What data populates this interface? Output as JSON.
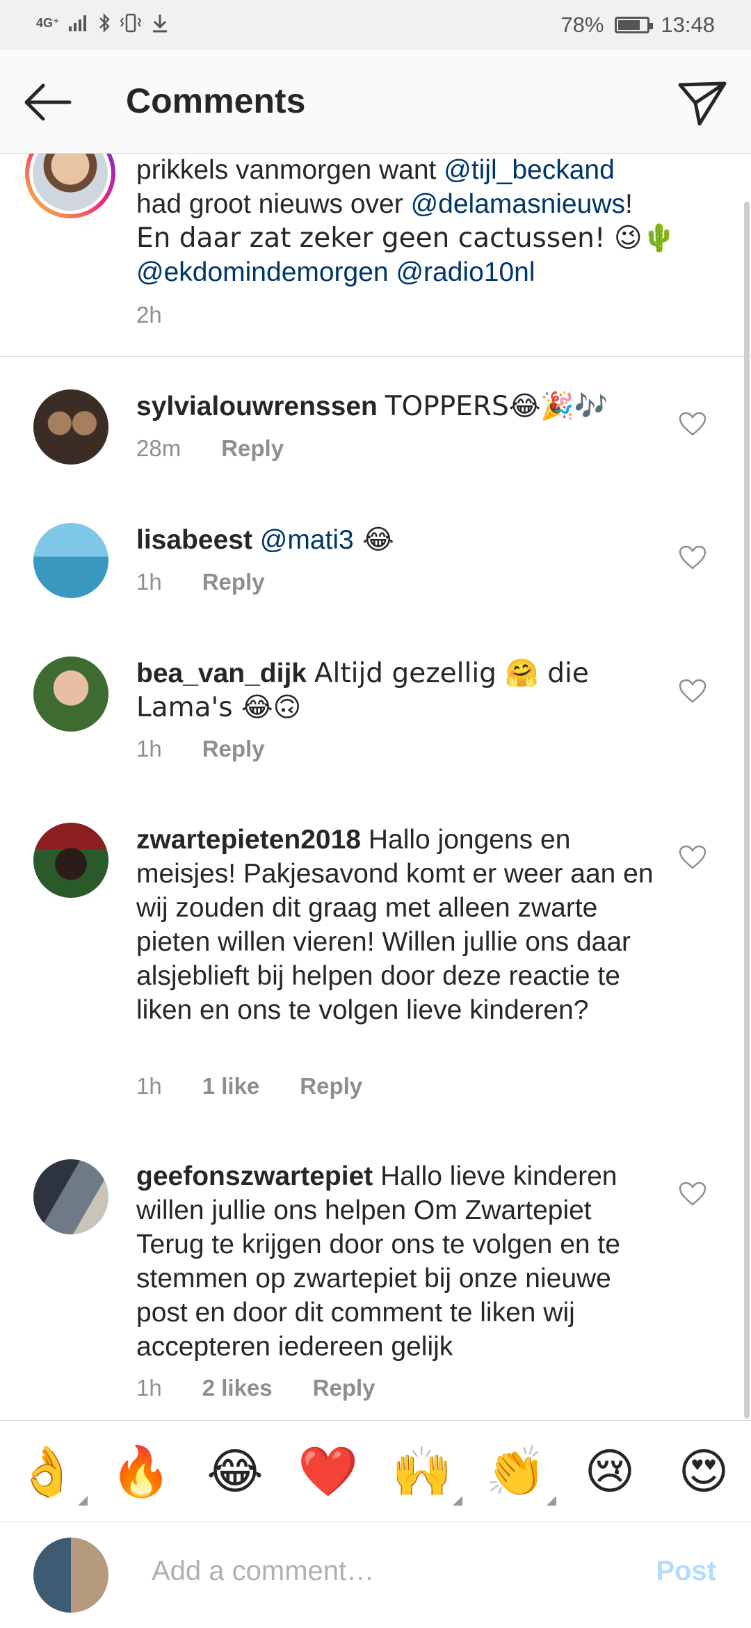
{
  "status_bar": {
    "network": "4G⁺",
    "battery_percent": "78%",
    "battery_level": 0.78,
    "time": "13:48"
  },
  "header": {
    "title": "Comments"
  },
  "caption": {
    "line1_text": "prikkels vanmorgen want ",
    "line1_mention": "@tijl_beckand",
    "line2_text": "had groot nieuws over ",
    "line2_mention": "@delamasnieuws",
    "line2_end": "!",
    "line3_text": "En daar zat zeker geen cactussen! 😉🌵",
    "line4_mention1": "@ekdomindemorgen",
    "line4_mention2": "@radio10nl",
    "time": "2h"
  },
  "comments": [
    {
      "username": "sylvialouwrenssen",
      "text": "TOPPERS😂🎉🎶",
      "time": "28m",
      "likes": "",
      "reply": "Reply",
      "avatar_color": "#4a3a30"
    },
    {
      "username": "lisabeest",
      "mention": "@mati3",
      "text": " 😂",
      "time": "1h",
      "likes": "",
      "reply": "Reply",
      "avatar_color": "#5fb0d4"
    },
    {
      "username": "bea_van_dijk",
      "text": "Altijd gezellig 🤗 die Lama's 😂🙃",
      "time": "1h",
      "likes": "",
      "reply": "Reply",
      "avatar_color": "#5a7a3a"
    },
    {
      "username": "zwartepieten2018",
      "text": "Hallo jongens en meisjes! Pakjesavond komt er weer aan en wij zouden dit graag met alleen zwarte pieten willen vieren! Willen jullie ons daar alsjeblieft bij helpen door deze reactie te liken en ons te volgen lieve kinderen?",
      "time": "1h",
      "likes": "1 like",
      "reply": "Reply",
      "avatar_color": "#2b4a2a"
    },
    {
      "username": "geefonszwartepiet",
      "text": "Hallo lieve kinderen willen jullie ons helpen Om Zwartepiet Terug te krijgen door ons te volgen en te stemmen op zwartepiet bij onze nieuwe post en door dit comment te liken wij accepteren iedereen gelijk",
      "time": "1h",
      "likes": "2 likes",
      "reply": "Reply",
      "avatar_color": "#3a3a3a"
    }
  ],
  "emoji_bar": [
    {
      "glyph": "👌",
      "icon": "ok-hand-icon"
    },
    {
      "glyph": "🔥",
      "icon": "fire-icon"
    },
    {
      "glyph": "😂",
      "icon": "joy-icon"
    },
    {
      "glyph": "❤️",
      "icon": "heart-icon"
    },
    {
      "glyph": "🙌",
      "icon": "raised-hands-icon"
    },
    {
      "glyph": "👏",
      "icon": "clap-icon"
    },
    {
      "glyph": "😢",
      "icon": "cry-icon"
    },
    {
      "glyph": "😍",
      "icon": "heart-eyes-icon"
    }
  ],
  "composer": {
    "placeholder": "Add a comment…",
    "post_label": "Post"
  },
  "colors": {
    "link": "#003569",
    "meta": "#8e8e8e",
    "post_disabled": "#b3dbff"
  }
}
